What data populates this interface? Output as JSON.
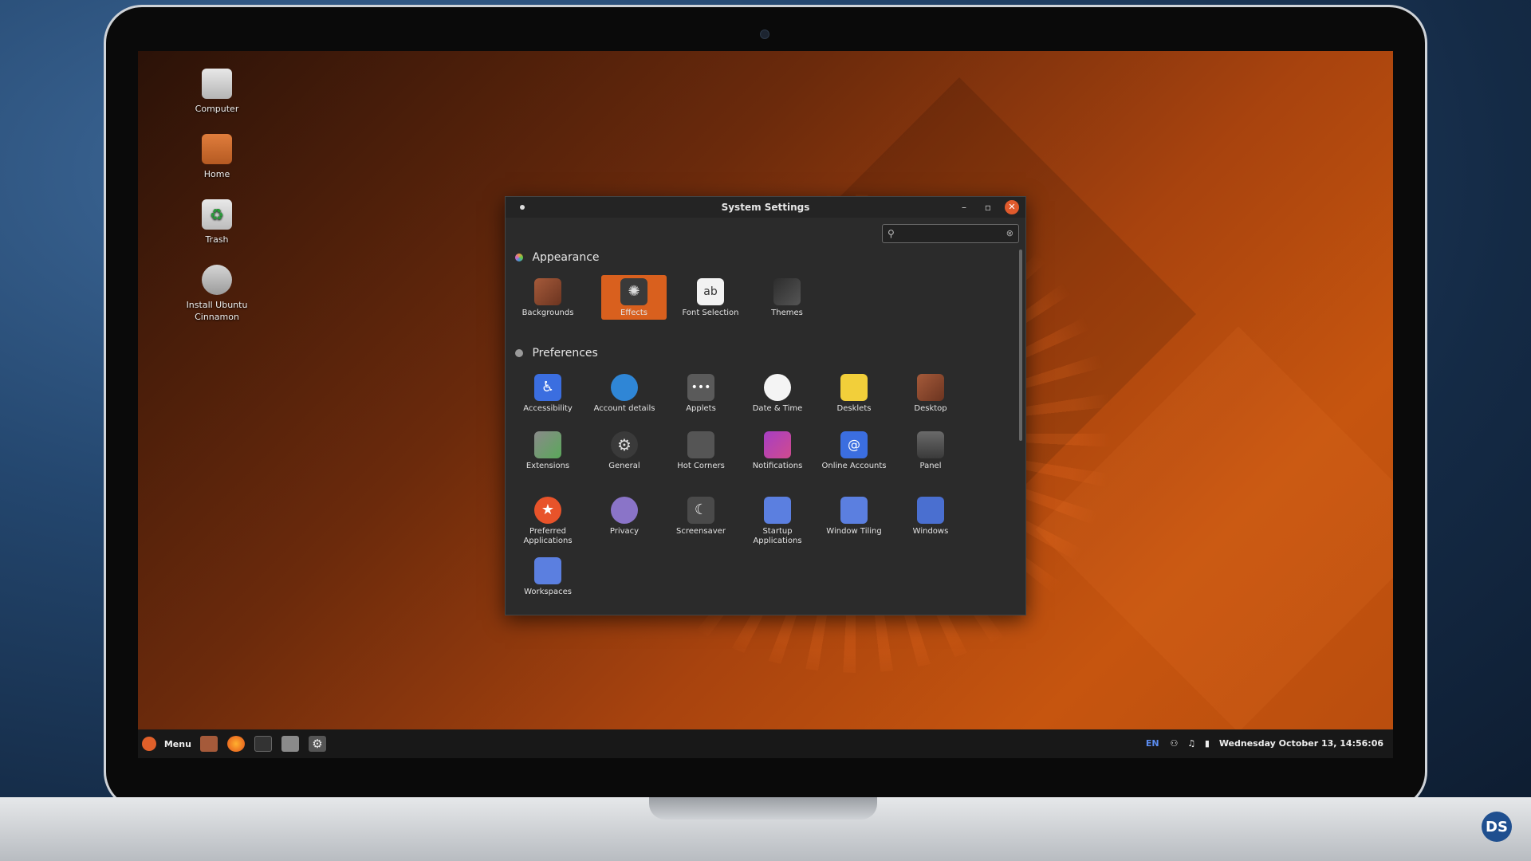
{
  "desktop": {
    "icons": [
      {
        "label": "Computer"
      },
      {
        "label": "Home"
      },
      {
        "label": "Trash"
      },
      {
        "label": "Install Ubuntu Cinnamon"
      }
    ]
  },
  "window": {
    "title": "System Settings",
    "search": {
      "value": "",
      "placeholder": ""
    },
    "sections": [
      {
        "title": "Appearance",
        "items": [
          "Backgrounds",
          "Effects",
          "Font Selection",
          "Themes"
        ],
        "selected": "Effects"
      },
      {
        "title": "Preferences",
        "items": [
          "Accessibility",
          "Account details",
          "Applets",
          "Date & Time",
          "Desklets",
          "Desktop",
          "Extensions",
          "General",
          "Hot Corners",
          "Notifications",
          "Online Accounts",
          "Panel",
          "Preferred Applications",
          "Privacy",
          "Screensaver",
          "Startup Applications",
          "Window Tiling",
          "Windows",
          "Workspaces"
        ]
      }
    ]
  },
  "taskbar": {
    "menu_label": "Menu",
    "tray": {
      "lang": "EN",
      "clock": "Wednesday October 13, 14:56:06"
    }
  },
  "watermark": "DS",
  "colors": {
    "accent": "#d9601e",
    "window_bg": "#2b2b2b",
    "taskbar_bg": "#181818"
  }
}
